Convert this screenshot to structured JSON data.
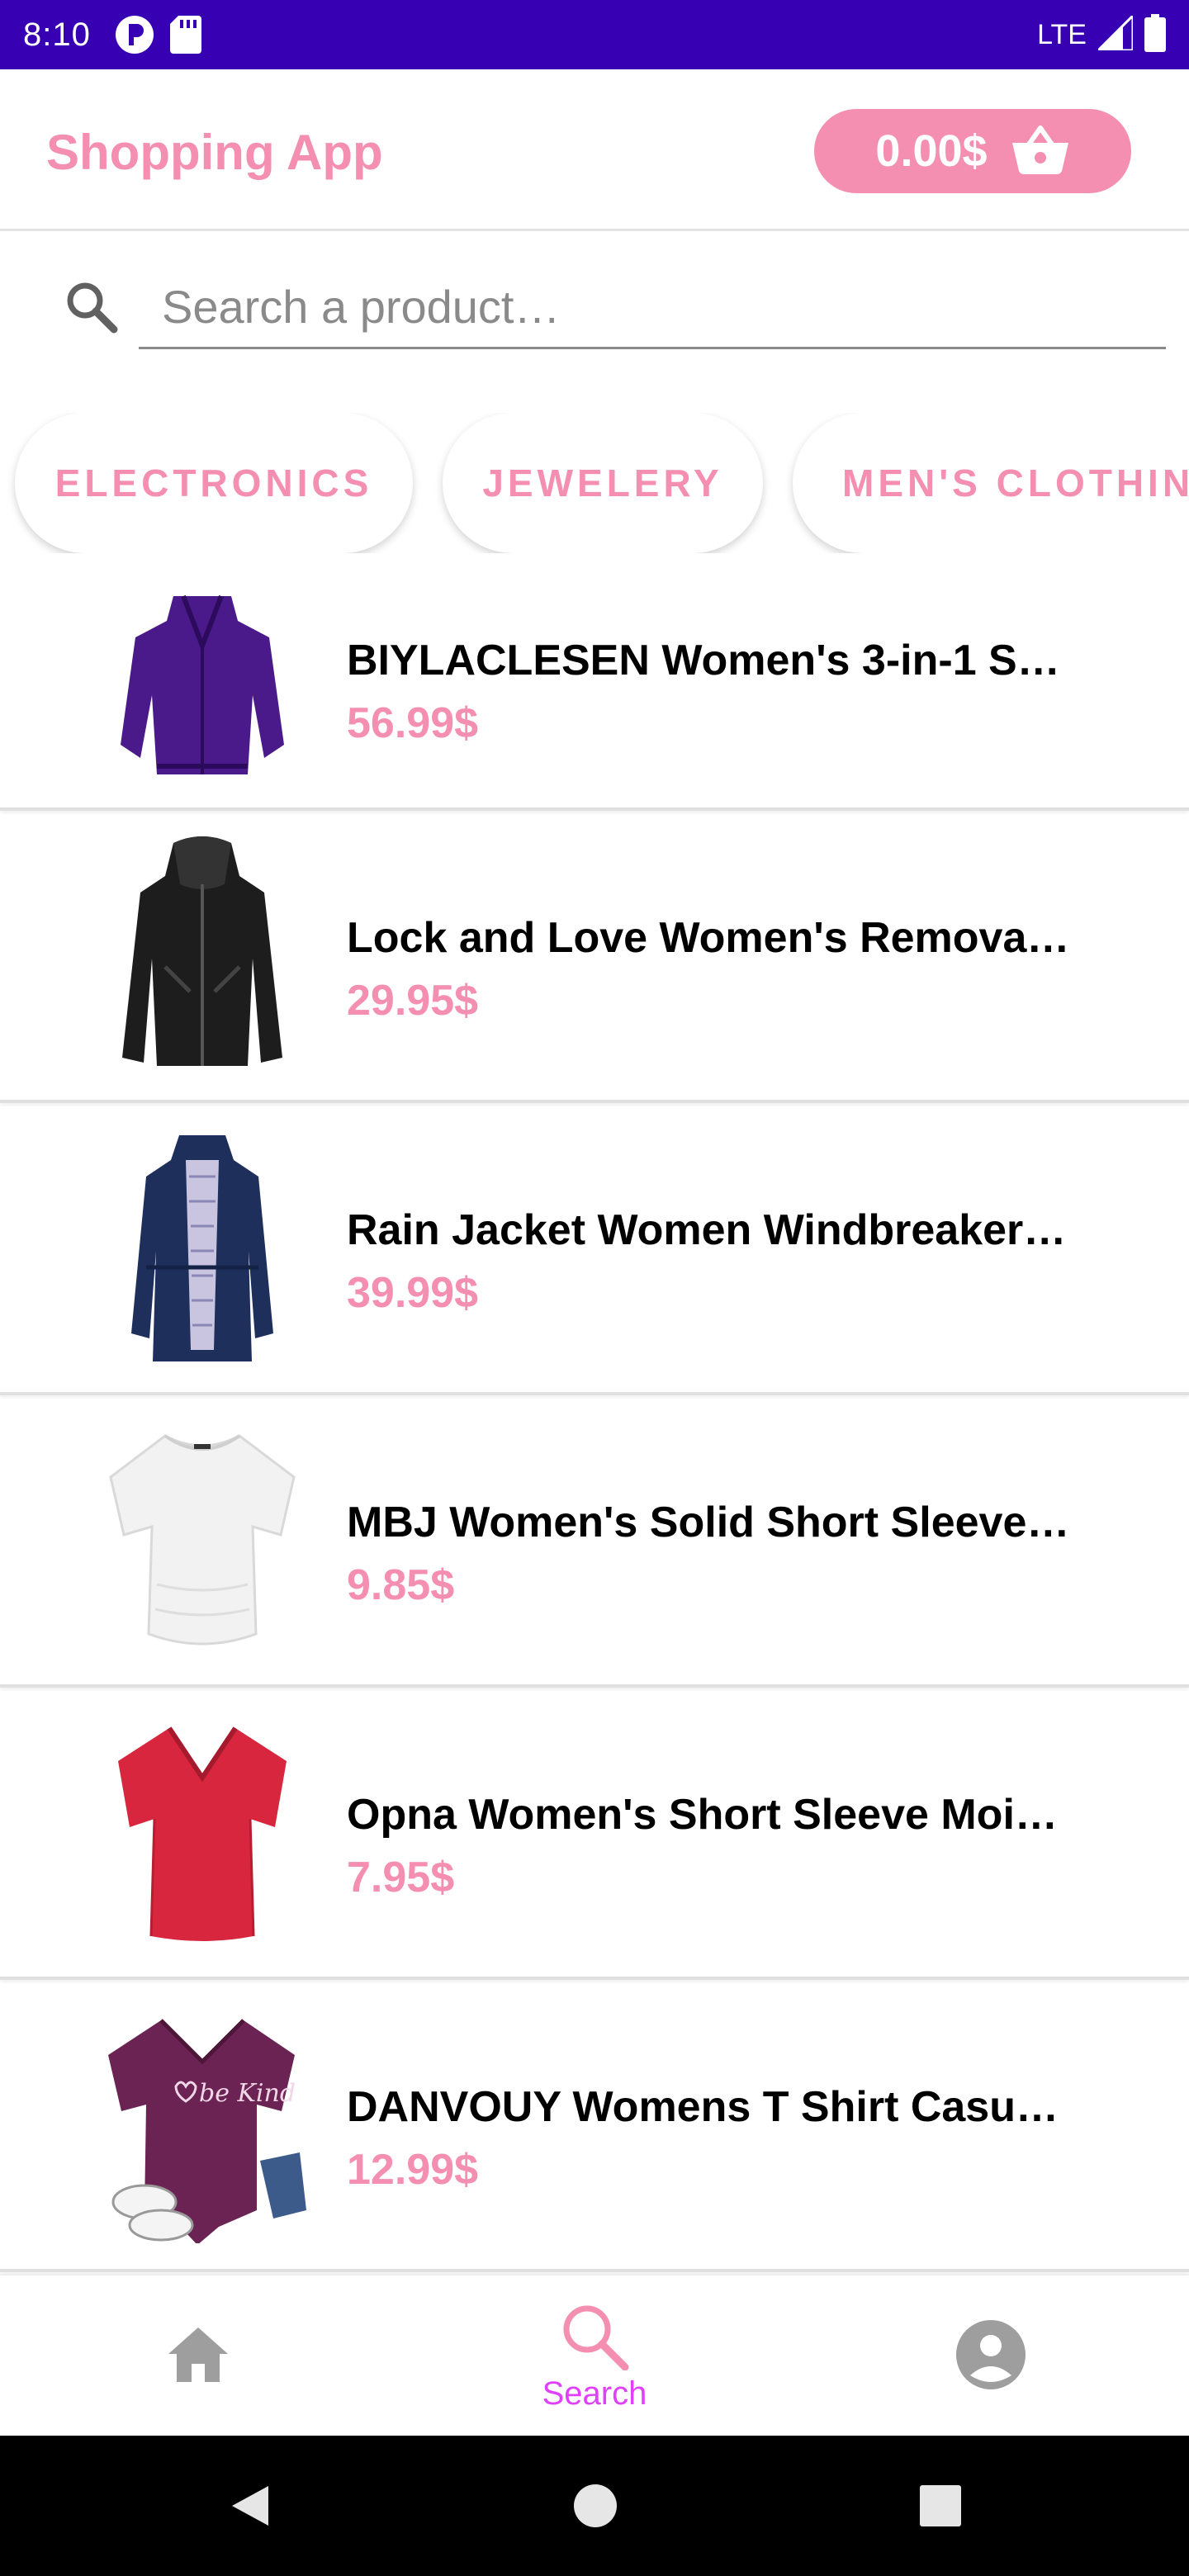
{
  "status_bar": {
    "time": "8:10",
    "network": "LTE"
  },
  "app_bar": {
    "title": "Shopping App",
    "cart_total": "0.00$"
  },
  "search": {
    "placeholder": "Search a product…",
    "value": ""
  },
  "categories": [
    {
      "label": "ELECTRONICS"
    },
    {
      "label": "JEWELERY"
    },
    {
      "label": "MEN'S CLOTHING"
    }
  ],
  "products": [
    {
      "title": "BIYLACLESEN Women's 3-in-1 S…",
      "price": "56.99$",
      "image": "purple-jacket"
    },
    {
      "title": "Lock and Love Women's Remova…",
      "price": "29.95$",
      "image": "black-leather-jacket"
    },
    {
      "title": "Rain Jacket Women Windbreaker…",
      "price": "39.99$",
      "image": "navy-rain-jacket"
    },
    {
      "title": "MBJ Women's Solid Short Sleeve…",
      "price": "9.85$",
      "image": "white-tshirt"
    },
    {
      "title": "Opna Women's Short Sleeve Moi…",
      "price": "7.95$",
      "image": "red-tshirt"
    },
    {
      "title": "DANVOUY Womens T Shirt Casu…",
      "price": "12.99$",
      "image": "purple-be-kind-tshirt",
      "print_text": "be Kind"
    }
  ],
  "bottom_nav": {
    "items": [
      {
        "label": "",
        "icon": "home-icon",
        "active": false
      },
      {
        "label": "Search",
        "icon": "search-icon",
        "active": true
      },
      {
        "label": "",
        "icon": "account-icon",
        "active": false
      }
    ]
  },
  "colors": {
    "status_bar": "#3700b3",
    "accent": "#f48fb1",
    "nav_active": "#e040fb",
    "nav_inactive": "#9e9e9e"
  }
}
